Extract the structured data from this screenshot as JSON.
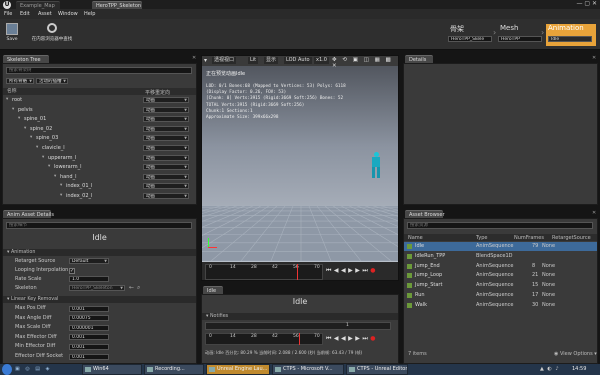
{
  "window": {
    "title_tab": "Example_Map",
    "asset_tab": "HeroTPP_Skeleton"
  },
  "menu": [
    "File",
    "Edit",
    "Asset",
    "Window",
    "Help"
  ],
  "toolbar": {
    "save": "Save",
    "find": "在内容浏览器中查找"
  },
  "breadcrumb": {
    "skeleton": {
      "title": "骨架",
      "value": "HeroTPP_Skele"
    },
    "mesh": {
      "title": "Mesh",
      "value": "HeroTPP"
    },
    "animation": {
      "title": "Animation",
      "value": "Idle"
    }
  },
  "skeleton_tree": {
    "tab": "Skeleton Tree",
    "search_placeholder": "搜索骨架树",
    "filter1": "所有骨骼",
    "filter2": "活动的插槽",
    "col_name": "名称",
    "col_translation": "平移重定向",
    "bones": [
      {
        "name": "root",
        "mode": "动画",
        "depth": 0
      },
      {
        "name": "pelvis",
        "mode": "动画",
        "depth": 1
      },
      {
        "name": "spine_01",
        "mode": "动画",
        "depth": 2
      },
      {
        "name": "spine_02",
        "mode": "动画",
        "depth": 3
      },
      {
        "name": "spine_03",
        "mode": "动画",
        "depth": 4
      },
      {
        "name": "clavicle_l",
        "mode": "动画",
        "depth": 5
      },
      {
        "name": "upperarm_l",
        "mode": "动画",
        "depth": 6
      },
      {
        "name": "lowerarm_l",
        "mode": "动画",
        "depth": 7
      },
      {
        "name": "hand_l",
        "mode": "动画",
        "depth": 8
      },
      {
        "name": "index_01_l",
        "mode": "动画",
        "depth": 9
      },
      {
        "name": "index_02_l",
        "mode": "动画",
        "depth": 9
      }
    ]
  },
  "asset_details": {
    "tab": "Anim Asset Details",
    "search_placeholder": "搜索细节",
    "title": "Idle",
    "animation_section": "Animation",
    "retarget_label": "Retarget Source",
    "retarget_value": "Default",
    "looping_label": "Looping Interpolation",
    "rate_label": "Rate Scale",
    "rate_value": "1.0",
    "skeleton_label": "Skeleton",
    "skeleton_value": "HeroTPP_Skeleton",
    "compression_section": "Linear Key Removal",
    "compression": [
      {
        "label": "Max Pos Diff",
        "value": "0.001"
      },
      {
        "label": "Max Angle Diff",
        "value": "0.00075"
      },
      {
        "label": "Max Scale Diff",
        "value": "0.000001"
      },
      {
        "label": "Max Effector Diff",
        "value": "0.001"
      },
      {
        "label": "Min Effector Diff",
        "value": "0.001"
      },
      {
        "label": "Effector Diff Socket",
        "value": "0.001"
      }
    ]
  },
  "viewport": {
    "view_mode": "透视视口",
    "lit": "Lit",
    "show": "显示",
    "lod": "LOD Auto",
    "speed": "x1.0",
    "preview_label": "正在预览动画Idle",
    "stats": [
      "LOD: 0/1 Bones:68 (Mapped to Vertices: 53) Polys: 6118",
      "(Display Factor: 0.26, FOV: 53)",
      "[Chunk: 0] Verts:3915 (Rigid:3669 Soft:256) Bones: 52",
      "TOTAL Verts:3915 (Rigid:3669 Soft:256)",
      "Chunk:1 Sections:1",
      "Approximate Size: 399x66x298"
    ],
    "ticks": [
      "0",
      "14",
      "28",
      "42",
      "56",
      "70"
    ]
  },
  "details": {
    "tab": "Details"
  },
  "anim_editor": {
    "tab": "Idle",
    "title": "Idle",
    "notifies": "Notifies",
    "track_value": "1",
    "ticks": [
      "0",
      "14",
      "28",
      "42",
      "56",
      "70"
    ],
    "status": "动画: Idle  百分比: 80.29 %  当前时间: 2.088 / 2.600 (秒)  当前帧: 63.43 / 79 (帧)"
  },
  "asset_browser": {
    "tab": "Asset Browser",
    "search_placeholder": "搜索资源",
    "columns": [
      "Name",
      "Type",
      "NumFrames",
      "RetargetSource"
    ],
    "items": [
      {
        "name": "Idle",
        "type": "AnimSequence",
        "frames": "79",
        "source": "None"
      },
      {
        "name": "IdleRun_TPP",
        "type": "BlendSpace1D",
        "frames": "",
        "source": ""
      },
      {
        "name": "Jump_End",
        "type": "AnimSequence",
        "frames": "8",
        "source": "None"
      },
      {
        "name": "Jump_Loop",
        "type": "AnimSequence",
        "frames": "21",
        "source": "None"
      },
      {
        "name": "Jump_Start",
        "type": "AnimSequence",
        "frames": "15",
        "source": "None"
      },
      {
        "name": "Run",
        "type": "AnimSequence",
        "frames": "17",
        "source": "None"
      },
      {
        "name": "Walk",
        "type": "AnimSequence",
        "frames": "30",
        "source": "None"
      }
    ],
    "count": "7 items",
    "view_options": "View Options"
  },
  "taskbar": {
    "items": [
      "Win64",
      "Recording...",
      "Unreal Engine Lau...",
      "CTPS - Microsoft V...",
      "CTPS - Unreal Editor"
    ],
    "clock": "14:59"
  },
  "colors": {
    "accent_orange": "#e8a33a",
    "selected_row": "#3d6a9a",
    "viewport_sky": "#9aa4b3"
  }
}
